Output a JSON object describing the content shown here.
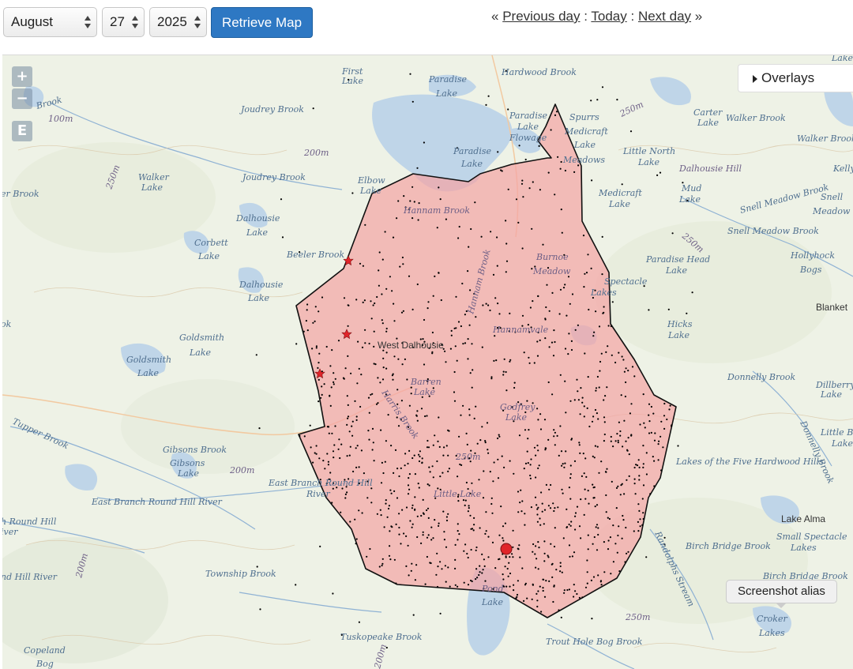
{
  "controls": {
    "month": "August",
    "day": "27",
    "year": "2025",
    "retrieve_label": "Retrieve Map"
  },
  "daynav": {
    "prefix": "«",
    "previous": "Previous day",
    "sep1": ":",
    "today": "Today",
    "sep2": ":",
    "next": "Next day",
    "suffix": "»"
  },
  "map": {
    "zoom_in": "+",
    "zoom_out": "−",
    "extra_button": "E",
    "overlays_label": "Overlays",
    "alias_label": "Screenshot alias",
    "colors": {
      "polygon_fill": "#f4a5a5",
      "polygon_stroke": "#111111",
      "water": "#bfd5e8",
      "land": "#eef2e6",
      "star": "#e0252a",
      "marker": "#e0252a"
    },
    "labels": {
      "first_lake": "First",
      "first_lake2": "Lake",
      "paradise_lake_top": "Paradise",
      "paradise_lake_top2": "Lake",
      "hardwood_brook": "Hardwood Brook",
      "lake_tr": "Lake",
      "joudrey_brook1": "Joudrey Brook",
      "joudrey_brook2": "Joudrey Brook",
      "brook_left": "Brook",
      "m100": "100m",
      "m200a": "200m",
      "m250a": "250m",
      "paradise2": "Paradise",
      "paradise2b": "Lake",
      "flowage": "Flowage",
      "spurrs": "Spurrs",
      "medicraft": "Medicraft",
      "lake_m": "Lake",
      "meadows": "Meadows",
      "little_north": "Little North",
      "little_north2": "Lake",
      "carter": "Carter",
      "carter2": "Lake",
      "walker_brook_r": "Walker Brook",
      "walker_brook_r2": "Walker Brook",
      "dalhousie_hill": "Dalhousie Hill",
      "kelly": "Kelly",
      "paradise3": "Paradise",
      "paradise3b": "Lake",
      "elbow": "Elbow",
      "elbow2": "Lake",
      "walker_l": "Walker",
      "walker_l2": "Lake",
      "er_brook": "er Brook",
      "m250b": "250m",
      "hannam_brook": "Hannam Brook",
      "medicraft2": "Medicraft",
      "medicraft2b": "Lake",
      "mud": "Mud",
      "mud2": "Lake",
      "snell_meadow_brook": "Snell Meadow Brook",
      "snell": "Snell",
      "snell2": "Meadow",
      "dalhousie_l1": "Dalhousie",
      "dalhousie_l1b": "Lake",
      "corbett": "Corbett",
      "corbett2": "Lake",
      "beeler_brook": "Beeler Brook",
      "m250c": "250m",
      "snell_meadow_brook2": "Snell Meadow Brook",
      "burnoe": "Burnoe",
      "burnoe2": "Meadow",
      "paradise_head": "Paradise Head",
      "paradise_head2": "Lake",
      "hollyhock": "Hollyhock",
      "hollyhock2": "Bogs",
      "dalhousie_l2": "Dalhousie",
      "dalhousie_l2b": "Lake",
      "spectacle": "Spectacle",
      "spectacle2": "Lakes",
      "blanket": "Blanket",
      "ok": "ok",
      "hannam_brook_v": "Hannam Brook",
      "hannamvale": "Hannamvale",
      "goldsmith1": "Goldsmith",
      "goldsmith1b": "Lake",
      "west_dalhousie": "West Dalhousie",
      "hicks": "Hicks",
      "hicks2": "Lake",
      "goldsmith2": "Goldsmith",
      "goldsmith2b": "Lake",
      "barren": "Barren",
      "barren2": "Lake",
      "donnelly_brook": "Donnelly Brook",
      "dillberry": "Dillberry",
      "dillberry2": "Lake",
      "tupper_brook": "Tupper Brook",
      "harris_brook": "Harris Brook",
      "godfrey": "Godfrey",
      "godfrey2": "Lake",
      "donnelly_brook2": "Donnelly Brook",
      "little_b": "Little B",
      "little_b2": "Lake",
      "gibsons_brook": "Gibsons Brook",
      "gibsons": "Gibsons",
      "gibsons2": "Lake",
      "m200b": "200m",
      "m250d": "250m",
      "lakes_five": "Lakes of the Five Hardwood Hills",
      "east_branch_river": "East Branch Round Hill",
      "east_branch_river2": "River",
      "east_branch_rhr": "East Branch Round Hill River",
      "little_lake": "Little Lake",
      "h_round_hill": "h Round Hill",
      "iver": "iver",
      "randolphs_stream": "Randolphs Stream",
      "lake_alma": "Lake Alma",
      "small_spectacle": "Small Spectacle",
      "small_spectacle2": "Lakes",
      "birch_bridge_brook": "Birch Bridge Brook",
      "m200c": "200m",
      "township_brook": "Township Brook",
      "nd_hill_river": "nd Hill River",
      "birch_bridge_brook2": "Birch Bridge Brook",
      "pond": "Pond",
      "pond2": "Lake",
      "m250e": "250m",
      "croker": "Croker",
      "croker2": "Lakes",
      "tuskopeake_brook": "Tuskopeake Brook",
      "trout_hole": "Trout Hole Bog Brook",
      "m200d": "200m",
      "copeland": "Copeland",
      "copeland2": "Bog"
    }
  }
}
